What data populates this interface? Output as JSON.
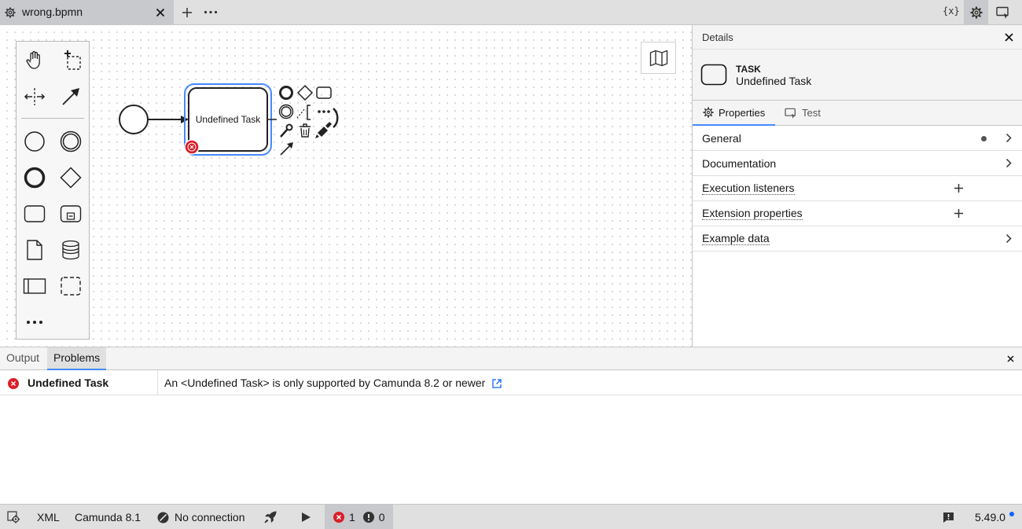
{
  "tab": {
    "title": "wrong.bpmn"
  },
  "top_bar": {
    "variables_label": "{x}"
  },
  "diagram": {
    "task_label": "Undefined Task"
  },
  "details": {
    "title": "Details",
    "element_type": "TASK",
    "element_name": "Undefined Task",
    "tabs": {
      "properties": "Properties",
      "test": "Test"
    },
    "groups": [
      {
        "label": "General"
      },
      {
        "label": "Documentation"
      },
      {
        "label": "Execution listeners"
      },
      {
        "label": "Extension properties"
      },
      {
        "label": "Example data"
      }
    ]
  },
  "bottom_panel": {
    "tabs": {
      "output": "Output",
      "problems": "Problems"
    },
    "problem": {
      "element": "Undefined Task",
      "message": "An <Undefined Task> is only supported by Camunda 8.2 or newer"
    }
  },
  "status_bar": {
    "xml": "XML",
    "platform": "Camunda 8.1",
    "connection": "No connection",
    "error_count": "1",
    "warning_count": "0",
    "version": "5.49.0"
  },
  "colors": {
    "selection": "#4589ff",
    "error": "#da1e28",
    "accent": "#0f62fe"
  }
}
